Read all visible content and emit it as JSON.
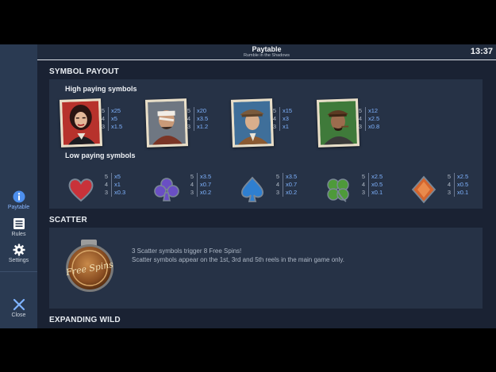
{
  "header": {
    "title": "Paytable",
    "subtitle": "Rumble in the Shadows",
    "clock": "13:37"
  },
  "sidebar": {
    "items": [
      {
        "label": "Paytable",
        "icon": "info-icon",
        "active": true
      },
      {
        "label": "Rules",
        "icon": "rules-icon",
        "active": false
      },
      {
        "label": "Settings",
        "icon": "gear-icon",
        "active": false
      }
    ],
    "close_label": "Close"
  },
  "sections": {
    "symbol_payout": "SYMBOL PAYOUT",
    "high_paying": "High paying symbols",
    "low_paying": "Low paying symbols",
    "scatter": "SCATTER",
    "expanding_wild": "EXPANDING WILD"
  },
  "high_symbols": [
    {
      "icon": "woman-portrait-icon",
      "pays": [
        {
          "count": "5",
          "mult": "x25"
        },
        {
          "count": "4",
          "mult": "x5"
        },
        {
          "count": "3",
          "mult": "x1.5"
        }
      ]
    },
    {
      "icon": "bandaged-man-portrait-icon",
      "pays": [
        {
          "count": "5",
          "mult": "x20"
        },
        {
          "count": "4",
          "mult": "x3.5"
        },
        {
          "count": "3",
          "mult": "x1.2"
        }
      ]
    },
    {
      "icon": "hat-man-portrait-icon",
      "pays": [
        {
          "count": "5",
          "mult": "x15"
        },
        {
          "count": "4",
          "mult": "x3"
        },
        {
          "count": "3",
          "mult": "x1"
        }
      ]
    },
    {
      "icon": "cigar-man-portrait-icon",
      "pays": [
        {
          "count": "5",
          "mult": "x12"
        },
        {
          "count": "4",
          "mult": "x2.5"
        },
        {
          "count": "3",
          "mult": "x0.8"
        }
      ]
    }
  ],
  "low_symbols": [
    {
      "icon": "heart-icon",
      "color": "#c9323a",
      "pays": [
        {
          "count": "5",
          "mult": "x5"
        },
        {
          "count": "4",
          "mult": "x1"
        },
        {
          "count": "3",
          "mult": "x0.3"
        }
      ]
    },
    {
      "icon": "club-icon",
      "color": "#6a4fc4",
      "pays": [
        {
          "count": "5",
          "mult": "x3.5"
        },
        {
          "count": "4",
          "mult": "x0.7"
        },
        {
          "count": "3",
          "mult": "x0.2"
        }
      ]
    },
    {
      "icon": "spade-icon",
      "color": "#2f7fd0",
      "pays": [
        {
          "count": "5",
          "mult": "x3.5"
        },
        {
          "count": "4",
          "mult": "x0.7"
        },
        {
          "count": "3",
          "mult": "x0.2"
        }
      ]
    },
    {
      "icon": "clover-icon",
      "color": "#4e9a3a",
      "pays": [
        {
          "count": "5",
          "mult": "x2.5"
        },
        {
          "count": "4",
          "mult": "x0.5"
        },
        {
          "count": "3",
          "mult": "x0.1"
        }
      ]
    },
    {
      "icon": "diamond-icon",
      "color": "#d4652e",
      "pays": [
        {
          "count": "5",
          "mult": "x2.5"
        },
        {
          "count": "4",
          "mult": "x0.5"
        },
        {
          "count": "3",
          "mult": "x0.1"
        }
      ]
    }
  ],
  "scatter": {
    "badge_text": "Free Spins",
    "line1": "3 Scatter symbols trigger 8 Free Spins!",
    "line2": "Scatter symbols appear on the 1st, 3rd and 5th reels in the main game only."
  },
  "colors": {
    "accent": "#7fb3ff",
    "background": "#1a2233",
    "panel": "#263246",
    "sidebar": "#2a3a52"
  }
}
